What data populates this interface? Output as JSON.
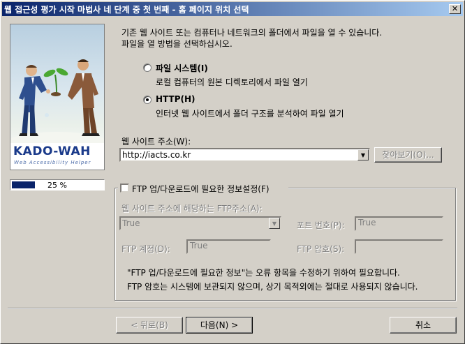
{
  "window": {
    "title": "웹 접근성 평가 시작 마법사 네 단계 중 첫 번째 - 홈 페이지 위치 선택",
    "close_glyph": "✕"
  },
  "sidebar": {
    "logo_text": "KADO-WAH",
    "logo_sub": "Web Accessibility Helper",
    "progress_text": "25 %",
    "progress_value": 0.25
  },
  "intro": {
    "line1": "기존 웹 사이트 또는 컴퓨터나 네트워크의 폴더에서 파일을 열 수 있습니다.",
    "line2": "파일을 열 방법을 선택하십시오."
  },
  "options": [
    {
      "label": "파일 시스템(I)",
      "desc": "로컬 컴퓨터의 원본 디렉토리에서 파일 열기",
      "checked": false
    },
    {
      "label": "HTTP(H)",
      "desc": "인터넷 웹 사이트에서 폴더 구조를 분석하여 파일 열기",
      "checked": true
    }
  ],
  "address": {
    "label": "웹 사이트 주소(W):",
    "value": "http://iacts.co.kr",
    "browse_label": "찾아보기(O)..."
  },
  "ftp": {
    "group_label": "FTP 업/다운로드에 필요한 정보설정(F)",
    "ftp_address_label": "웹 사이트 주소에 해당하는 FTP주소(A):",
    "ftp_address_value": "True",
    "port_label": "포트 번호(P):",
    "port_value": "True",
    "account_label": "FTP 계정(D):",
    "account_value": "True",
    "password_label": "FTP 암호(S):",
    "password_value": "",
    "note1": "\"FTP 업/다운로드에 필요한 정보\"는 오류 항목을 수정하기 위하여 필요합니다.",
    "note2": "FTP 암호는 시스템에 보관되지 않으며, 상기 목적외에는 절대로 사용되지 않습니다."
  },
  "buttons": {
    "back": "< 뒤로(B)",
    "next": "다음(N) >",
    "cancel": "취소"
  }
}
